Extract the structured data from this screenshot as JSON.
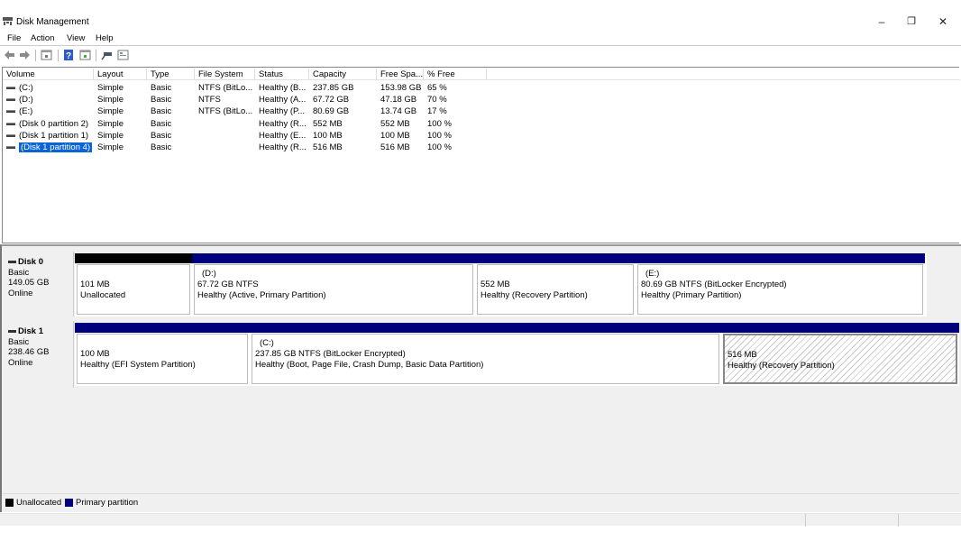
{
  "window": {
    "title": "Disk Management",
    "controls": {
      "minimize": "–",
      "restore": "❐",
      "close": "✕"
    }
  },
  "menu": [
    "File",
    "Action",
    "View",
    "Help"
  ],
  "toolbar": {
    "icons": [
      "back-icon",
      "forward-icon",
      "properties-icon",
      "help-icon",
      "rescan-icon",
      "connect-icon",
      "settings-icon"
    ]
  },
  "volume_list": {
    "columns": [
      "Volume",
      "Layout",
      "Type",
      "File System",
      "Status",
      "Capacity",
      "Free Spa...",
      "% Free"
    ],
    "rows": [
      {
        "volume": "(C:)",
        "layout": "Simple",
        "type": "Basic",
        "fs": "NTFS (BitLo...",
        "status": "Healthy (B...",
        "capacity": "237.85 GB",
        "free": "153.98 GB",
        "pct": "65 %"
      },
      {
        "volume": "(D:)",
        "layout": "Simple",
        "type": "Basic",
        "fs": "NTFS",
        "status": "Healthy (A...",
        "capacity": "67.72 GB",
        "free": "47.18 GB",
        "pct": "70 %"
      },
      {
        "volume": "(E:)",
        "layout": "Simple",
        "type": "Basic",
        "fs": "NTFS (BitLo...",
        "status": "Healthy (P...",
        "capacity": "80.69 GB",
        "free": "13.74 GB",
        "pct": "17 %"
      },
      {
        "volume": "(Disk 0 partition 2)",
        "layout": "Simple",
        "type": "Basic",
        "fs": "",
        "status": "Healthy (R...",
        "capacity": "552 MB",
        "free": "552 MB",
        "pct": "100 %"
      },
      {
        "volume": "(Disk 1 partition 1)",
        "layout": "Simple",
        "type": "Basic",
        "fs": "",
        "status": "Healthy (E...",
        "capacity": "100 MB",
        "free": "100 MB",
        "pct": "100 %"
      },
      {
        "volume": "(Disk 1 partition 4)",
        "layout": "Simple",
        "type": "Basic",
        "fs": "",
        "status": "Healthy (R...",
        "capacity": "516 MB",
        "free": "516 MB",
        "pct": "100 %",
        "selected": true
      }
    ]
  },
  "disks": [
    {
      "name": "Disk 0",
      "type": "Basic",
      "size": "149.05 GB",
      "state": "Online",
      "partitions": [
        {
          "label": "",
          "line1": "101 MB",
          "line2": "Unallocated",
          "kind": "unallocated"
        },
        {
          "label": "(D:)",
          "line1": "67.72 GB NTFS",
          "line2": "Healthy (Active, Primary Partition)",
          "kind": "primary"
        },
        {
          "label": "",
          "line1": "552 MB",
          "line2": "Healthy (Recovery Partition)",
          "kind": "primary"
        },
        {
          "label": "(E:)",
          "line1": "80.69 GB NTFS (BitLocker Encrypted)",
          "line2": "Healthy (Primary Partition)",
          "kind": "primary"
        }
      ]
    },
    {
      "name": "Disk 1",
      "type": "Basic",
      "size": "238.46 GB",
      "state": "Online",
      "partitions": [
        {
          "label": "",
          "line1": "100 MB",
          "line2": "Healthy (EFI System Partition)",
          "kind": "primary"
        },
        {
          "label": "(C:)",
          "line1": "237.85 GB NTFS (BitLocker Encrypted)",
          "line2": "Healthy (Boot, Page File, Crash Dump, Basic Data Partition)",
          "kind": "primary"
        },
        {
          "label": "",
          "line1": "516 MB",
          "line2": "Healthy (Recovery Partition)",
          "kind": "primary",
          "selected": true
        }
      ]
    }
  ],
  "legend": [
    {
      "label": "Unallocated",
      "color": "#000000"
    },
    {
      "label": "Primary partition",
      "color": "#00007f"
    }
  ]
}
